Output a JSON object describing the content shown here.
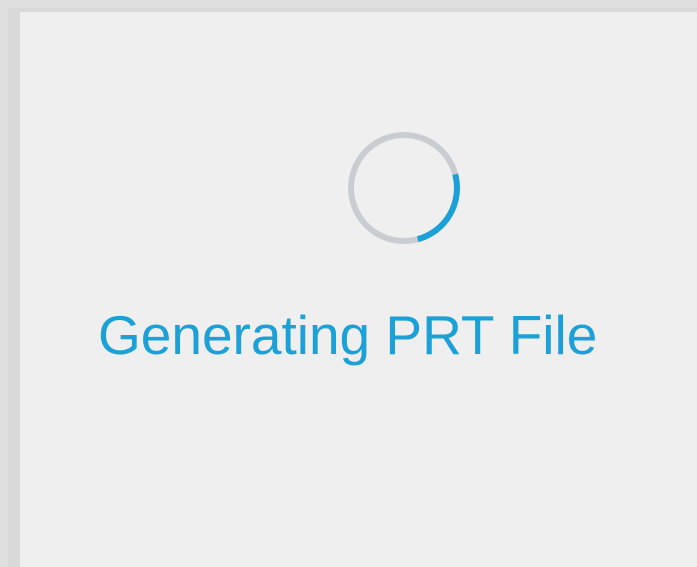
{
  "dialog": {
    "status_text": "Generating PRT File",
    "spinner_icon": "loading-spinner-icon"
  },
  "progress": {
    "fraction": 0.25
  },
  "colors": {
    "accent": "#1ba0d7",
    "spinner_track": "#c9cdd1",
    "panel_background": "#efefef",
    "frame_border": "#d9d9d9"
  }
}
